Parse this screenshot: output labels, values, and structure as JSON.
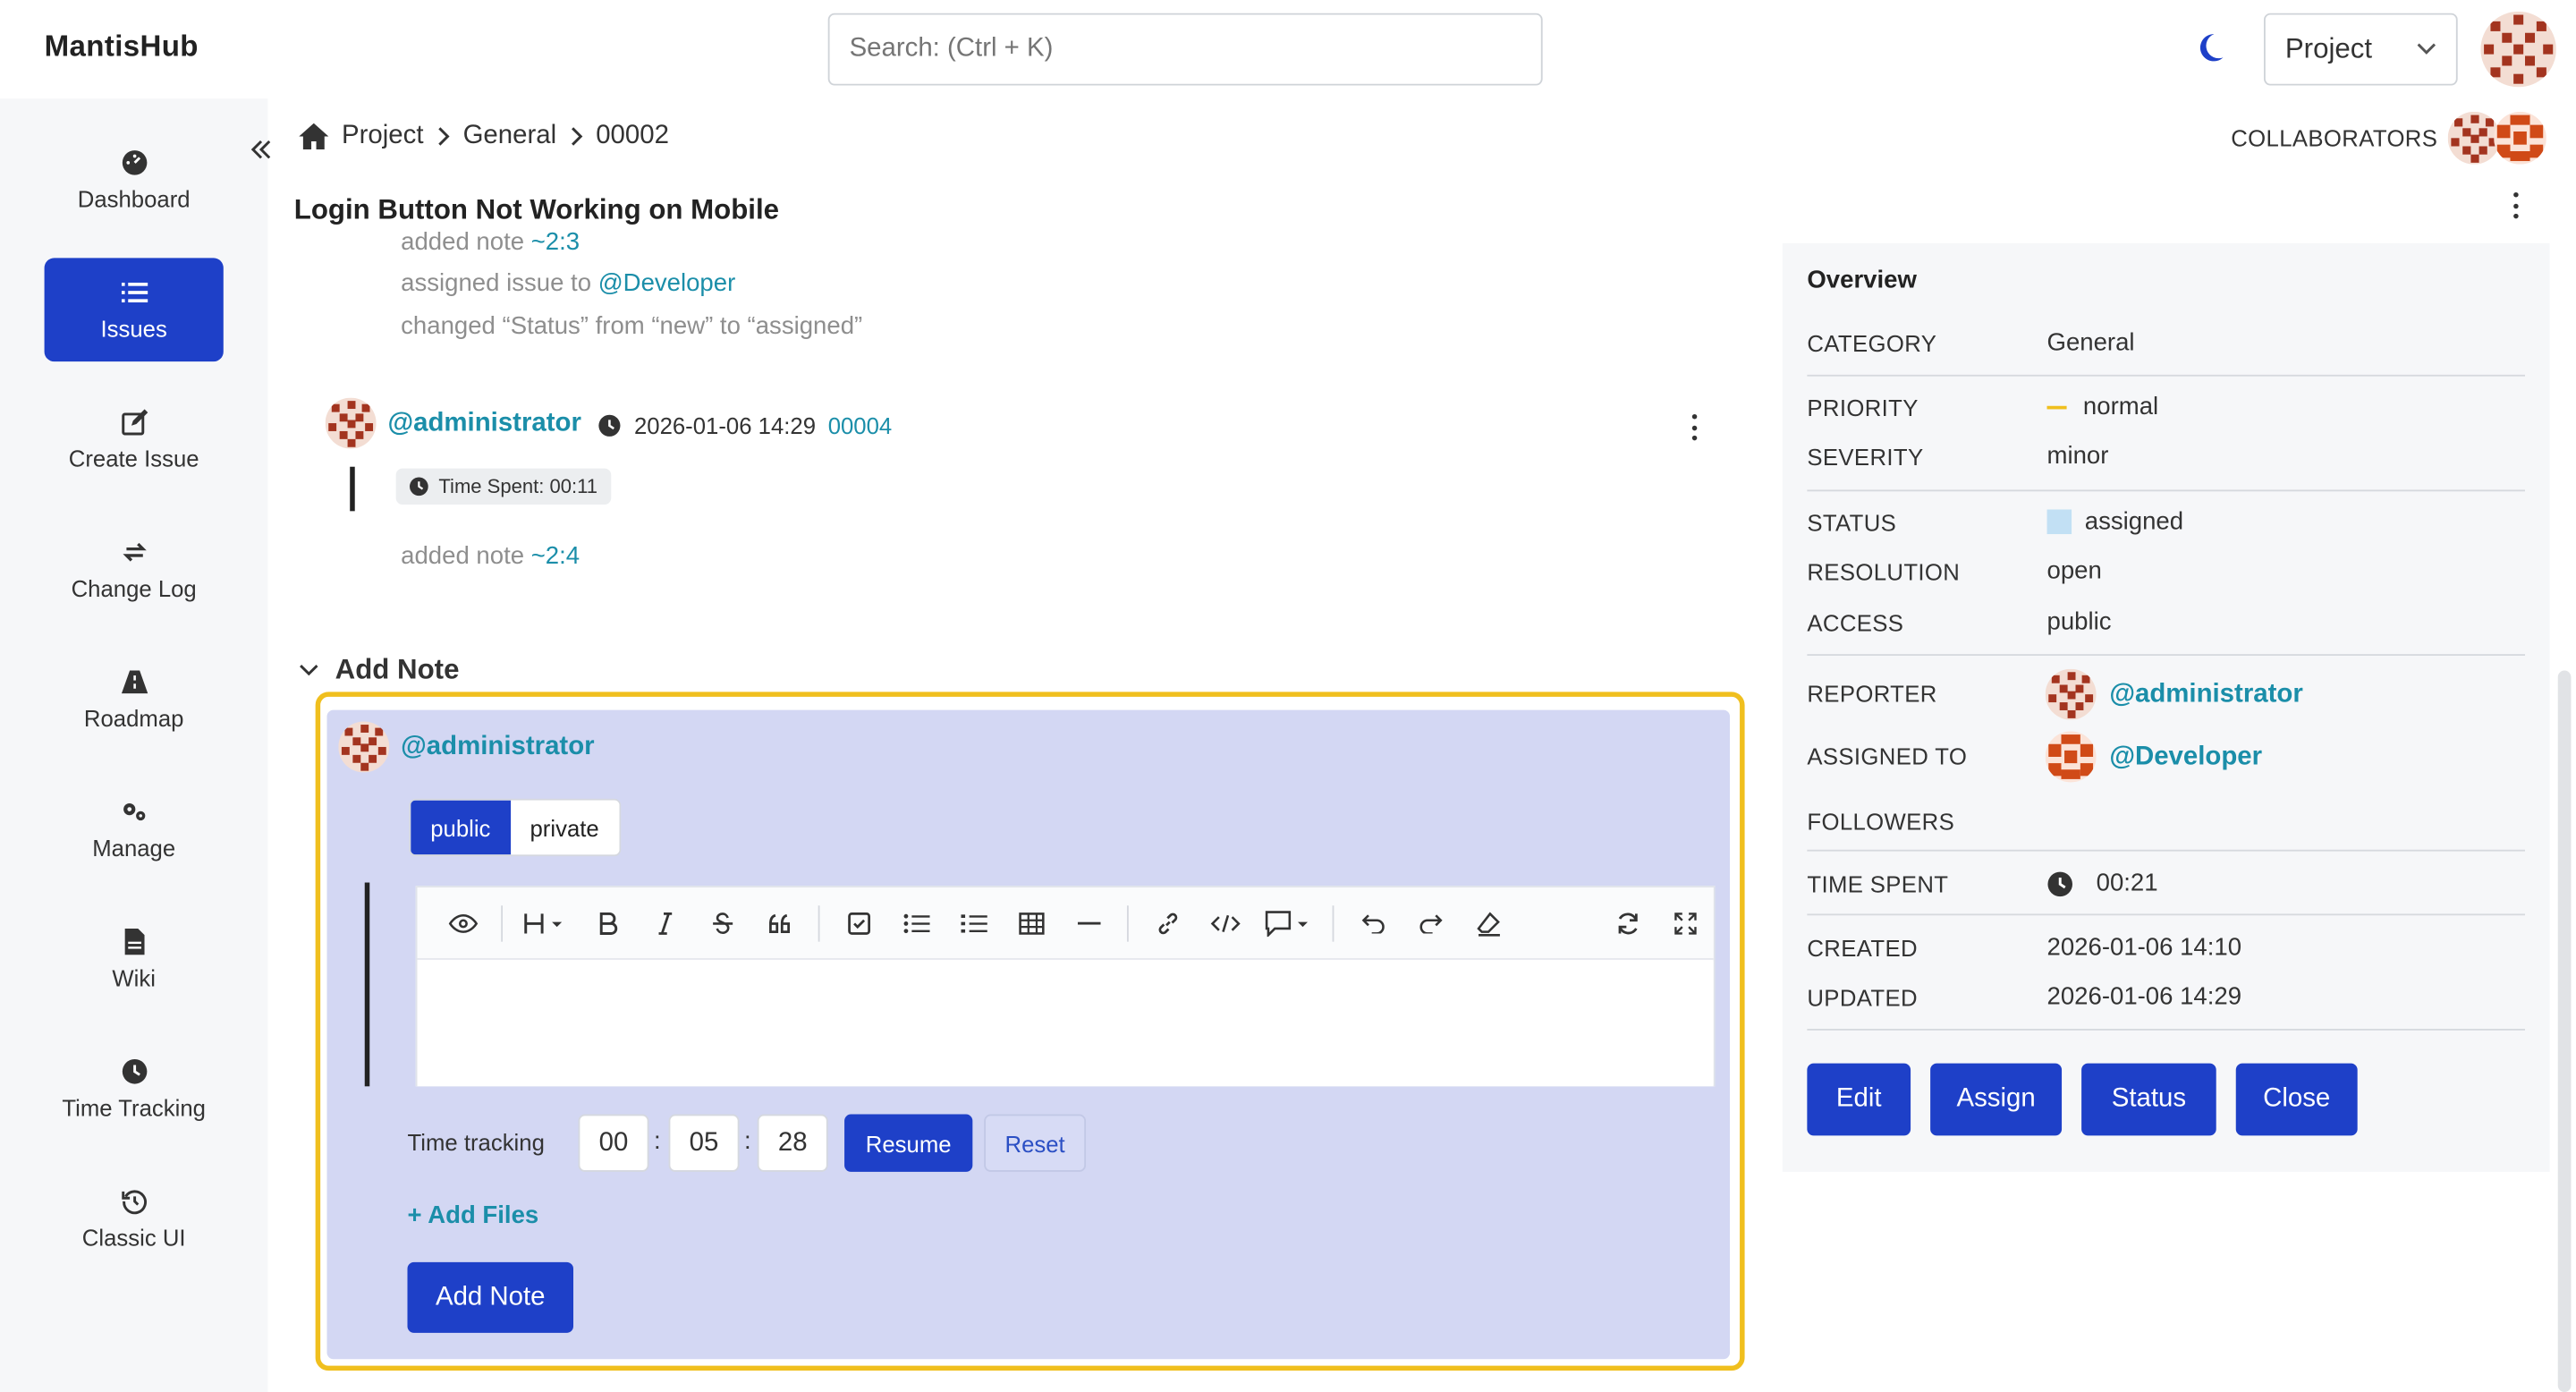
{
  "header": {
    "brand": "MantisHub",
    "search_placeholder": "Search: (Ctrl + K)",
    "project_select": "Project"
  },
  "sidebar": {
    "items": [
      {
        "label": "Dashboard",
        "icon": "dashboard-icon"
      },
      {
        "label": "Issues",
        "icon": "list-icon",
        "active": true
      },
      {
        "label": "Create Issue",
        "icon": "edit-icon"
      },
      {
        "label": "Change Log",
        "icon": "refresh-icon"
      },
      {
        "label": "Roadmap",
        "icon": "road-icon"
      },
      {
        "label": "Manage",
        "icon": "gears-icon"
      },
      {
        "label": "Wiki",
        "icon": "document-icon"
      },
      {
        "label": "Time Tracking",
        "icon": "clock-icon"
      },
      {
        "label": "Classic UI",
        "icon": "history-icon"
      }
    ]
  },
  "breadcrumb": [
    "Project",
    "General",
    "00002"
  ],
  "issue_title": "Login Button Not Working on Mobile",
  "collaborators_label": "COLLABORATORS",
  "history": {
    "line1_prefix": "added note ",
    "line1_link": "~2:3",
    "line2_prefix": "assigned issue to ",
    "line2_link": "@Developer",
    "line3": "changed “Status” from “new” to “assigned”"
  },
  "note_entry": {
    "author": "@administrator",
    "timestamp": "2026-01-06 14:29",
    "note_id": "00004",
    "time_spent": "Time Spent: 00:11",
    "added_prefix": "added note ",
    "added_link": "~2:4"
  },
  "add_note": {
    "heading": "Add Note",
    "author": "@administrator",
    "visibility": {
      "public": "public",
      "private": "private"
    },
    "time_tracking_label": "Time tracking",
    "hours": "00",
    "minutes": "05",
    "seconds": "28",
    "resume_label": "Resume",
    "reset_label": "Reset",
    "add_files_label": "+ Add Files",
    "submit_label": "Add Note"
  },
  "overview": {
    "title": "Overview",
    "rows": {
      "category": {
        "key": "CATEGORY",
        "value": "General"
      },
      "priority": {
        "key": "PRIORITY",
        "value": "normal"
      },
      "severity": {
        "key": "SEVERITY",
        "value": "minor"
      },
      "status": {
        "key": "STATUS",
        "value": "assigned"
      },
      "resolution": {
        "key": "RESOLUTION",
        "value": "open"
      },
      "access": {
        "key": "ACCESS",
        "value": "public"
      },
      "reporter": {
        "key": "REPORTER",
        "value": "@administrator"
      },
      "assigned_to": {
        "key": "ASSIGNED TO",
        "value": "@Developer"
      },
      "followers": {
        "key": "FOLLOWERS",
        "value": ""
      },
      "time_spent": {
        "key": "TIME SPENT",
        "value": "00:21"
      },
      "created": {
        "key": "CREATED",
        "value": "2026-01-06 14:10"
      },
      "updated": {
        "key": "UPDATED",
        "value": "2026-01-06 14:29"
      }
    },
    "buttons": {
      "edit": "Edit",
      "assign": "Assign",
      "status": "Status",
      "close": "Close"
    }
  },
  "colors": {
    "primary": "#1e40c8",
    "link": "#1b8ea9",
    "highlight_border": "#f0bf1e",
    "note_panel": "#d3d7f3",
    "status_assigned": "#c2e0f4",
    "priority_normal": "#f0bf1e"
  }
}
